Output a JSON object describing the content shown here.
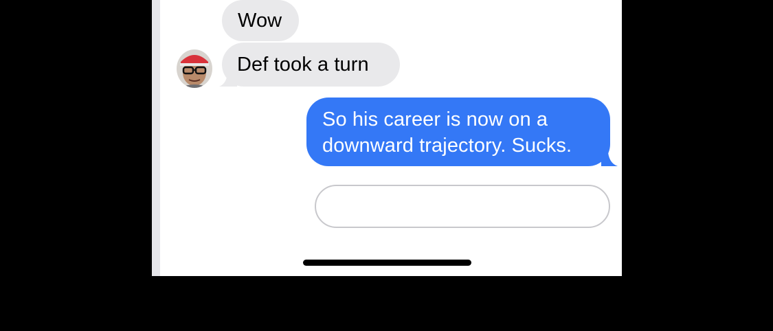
{
  "messages": [
    {
      "direction": "incoming",
      "text": "Wow"
    },
    {
      "direction": "incoming",
      "text": "Def took a turn"
    },
    {
      "direction": "outgoing",
      "text": "So his career is now on a downward trajectory. Sucks."
    }
  ],
  "composer": {
    "value": "",
    "placeholder": ""
  },
  "colors": {
    "incoming_bubble": "#e9e9eb",
    "outgoing_bubble": "#3478f6",
    "background": "#ffffff"
  },
  "icons": {
    "avatar": "contact-avatar"
  }
}
